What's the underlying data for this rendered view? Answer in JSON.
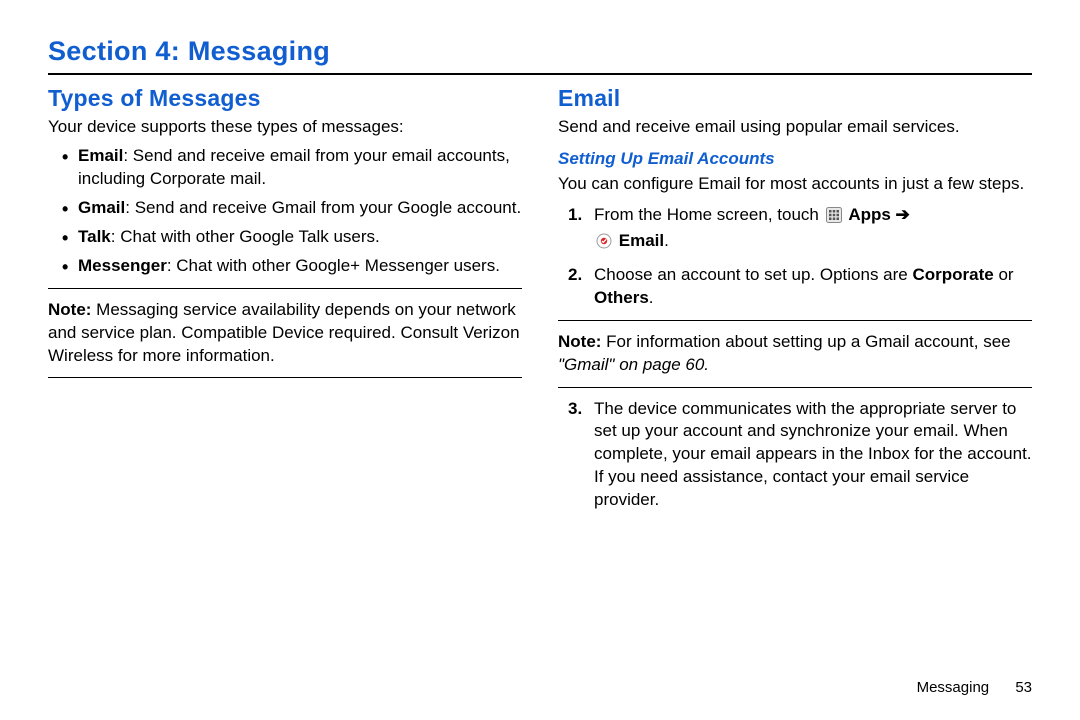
{
  "section_title": "Section 4: Messaging",
  "footer": {
    "chapter": "Messaging",
    "page": "53"
  },
  "left": {
    "heading": "Types of Messages",
    "intro": "Your device supports these types of messages:",
    "bullets": [
      {
        "label": "Email",
        "rest": ": Send and receive email from your email accounts, including Corporate mail."
      },
      {
        "label": "Gmail",
        "rest": ": Send and receive Gmail from your Google account."
      },
      {
        "label": "Talk",
        "rest": ": Chat with other Google Talk users."
      },
      {
        "label": "Messenger",
        "rest": ": Chat with other Google+ Messenger users."
      }
    ],
    "note_label": "Note:",
    "note_text": " Messaging service availability depends on your network and service plan. Compatible Device required. Consult Verizon Wireless for more information."
  },
  "right": {
    "heading": "Email",
    "intro": "Send and receive email using popular email services.",
    "sub_heading": "Setting Up Email Accounts",
    "sub_intro": "You can configure Email for most accounts in just a few steps.",
    "step1_a": "From the Home screen, touch ",
    "step1_apps": "Apps",
    "step1_arrow": " ➔",
    "step1_email": "Email",
    "step1_period": ".",
    "step2_a": "Choose an account to set up. Options are ",
    "step2_corp": "Corporate",
    "step2_mid": " or ",
    "step2_others": "Others",
    "step2_period": ".",
    "note_label": "Note:",
    "note_a": " For information about setting up a Gmail account, see ",
    "note_ref": "\"Gmail\"",
    "note_b": " on page 60.",
    "step3": "The device communicates with the appropriate server to set up your account and synchronize your email. When complete, your email appears in the Inbox for the account. If you need assistance, contact your email service provider."
  }
}
